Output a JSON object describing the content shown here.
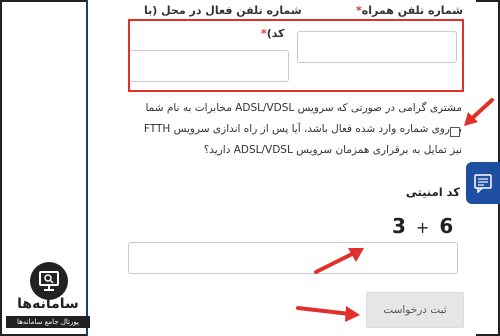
{
  "form": {
    "mobile_label": "شماره تلفن همراه",
    "landline_label_line1": "شماره تلفن فعال در محل (با",
    "landline_label_line2": "کد)",
    "required_mark": "*",
    "checkbox_text": "مشتری گرامی در صورتی که سرویس ADSL/VDSL مخابرات به نام شما بر روی شماره وارد شده فعال باشد، آیا پس از راه اندازی سرویس FTTH نیز تمایل به برقراری همزمان سرویس ADSL/VDSL دارید؟",
    "security_title": "کد امنیتی",
    "captcha_a": "3",
    "captcha_op": "+",
    "captcha_b": "6",
    "submit_label": "ثبت درخواست"
  },
  "logo": {
    "name": "سامانه‌ها",
    "tagline": "پورتال جامع سامانه‌ها"
  },
  "colors": {
    "highlight": "#e0302a",
    "side_tab": "#1e4fa0",
    "arrows": "#e0302a"
  },
  "icons": {
    "side_tab": "chat-form-icon",
    "logo": "search-monitor-icon"
  }
}
